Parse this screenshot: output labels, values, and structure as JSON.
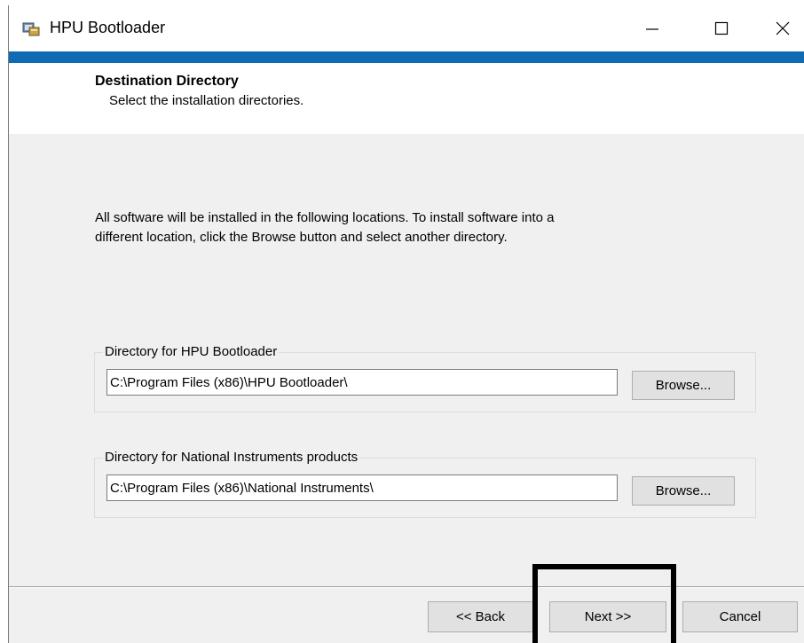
{
  "window": {
    "title": "HPU Bootloader",
    "icon": "installer-app-icon",
    "controls": [
      "minimize-icon",
      "maximize-icon",
      "close-icon"
    ],
    "accent_color": "#0f6cb4"
  },
  "header": {
    "title": "Destination Directory",
    "subtitle": "Select the installation directories."
  },
  "main": {
    "description_line1": "All software will be installed in the following locations. To install software into a",
    "description_line2": "different location, click the Browse button and select another directory.",
    "groups": [
      {
        "label": "Directory for HPU Bootloader",
        "path": "C:\\Program Files (x86)\\HPU Bootloader\\",
        "browse_label": "Browse..."
      },
      {
        "label": "Directory for National Instruments products",
        "path": "C:\\Program Files (x86)\\National Instruments\\",
        "browse_label": "Browse..."
      }
    ]
  },
  "footer": {
    "back_label": "<< Back",
    "next_label": "Next >>",
    "cancel_label": "Cancel"
  }
}
